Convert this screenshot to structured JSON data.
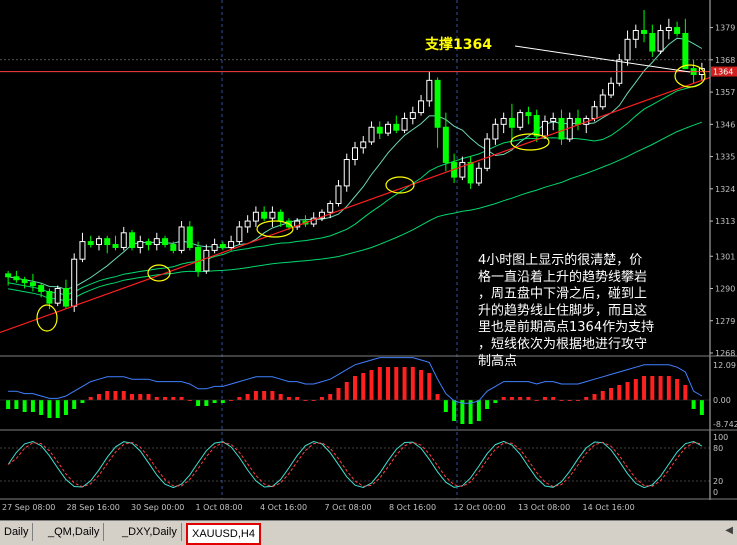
{
  "chart_data": {
    "type": "candlestick",
    "symbol": "XAUUSD",
    "timeframe": "H4",
    "colors": {
      "background": "#000000",
      "up_candle": "#ffffff",
      "down_candle": "#00ff00",
      "ma_fast": "#7fffd4",
      "ma_slow": "#00ff7f",
      "trendline": "#ff2020",
      "support_line": "#ff4040",
      "annotation": "#ffff00",
      "macd_pos": "#ff2020",
      "macd_neg": "#00ff00",
      "grid": "#3050a0"
    },
    "price_axis": {
      "ylim": [
        1268,
        1385
      ],
      "ticks": [
        "1379",
        "1368",
        "1364",
        "1357",
        "1346",
        "1335",
        "1324",
        "1313",
        "1301",
        "1290",
        "1279",
        "1268"
      ]
    },
    "time_axis": {
      "ticks": [
        "27 Sep 08:00",
        "28 Sep 16:00",
        "30 Sep 00:00",
        "1 Oct 08:00",
        "4 Oct 16:00",
        "7 Oct 08:00",
        "8 Oct 16:00",
        "12 Oct 00:00",
        "13 Oct 08:00",
        "14 Oct 16:00"
      ]
    },
    "candles": [
      [
        1295,
        1296,
        1291,
        1294
      ],
      [
        1294,
        1296,
        1292,
        1293
      ],
      [
        1293,
        1294,
        1290,
        1292
      ],
      [
        1292,
        1295,
        1289,
        1291
      ],
      [
        1291,
        1292,
        1287,
        1289
      ],
      [
        1289,
        1290,
        1283,
        1285
      ],
      [
        1285,
        1291,
        1284,
        1290
      ],
      [
        1290,
        1293,
        1283,
        1284
      ],
      [
        1284,
        1302,
        1282,
        1300
      ],
      [
        1300,
        1309,
        1299,
        1306
      ],
      [
        1306,
        1308,
        1304,
        1305
      ],
      [
        1305,
        1308,
        1303,
        1307
      ],
      [
        1307,
        1308,
        1302,
        1305
      ],
      [
        1305,
        1308,
        1303,
        1304
      ],
      [
        1304,
        1311,
        1303,
        1309
      ],
      [
        1309,
        1310,
        1303,
        1304
      ],
      [
        1304,
        1308,
        1302,
        1306
      ],
      [
        1306,
        1307,
        1303,
        1305
      ],
      [
        1305,
        1309,
        1303,
        1307
      ],
      [
        1307,
        1308,
        1304,
        1305
      ],
      [
        1305,
        1306,
        1302,
        1303
      ],
      [
        1303,
        1313,
        1302,
        1311
      ],
      [
        1311,
        1313,
        1303,
        1304
      ],
      [
        1304,
        1306,
        1294,
        1296
      ],
      [
        1296,
        1305,
        1295,
        1303
      ],
      [
        1303,
        1307,
        1302,
        1305
      ],
      [
        1305,
        1306,
        1303,
        1304
      ],
      [
        1304,
        1308,
        1303,
        1306
      ],
      [
        1306,
        1313,
        1305,
        1311
      ],
      [
        1311,
        1315,
        1309,
        1313
      ],
      [
        1313,
        1318,
        1311,
        1316
      ],
      [
        1316,
        1318,
        1313,
        1314
      ],
      [
        1314,
        1318,
        1311,
        1316
      ],
      [
        1316,
        1317,
        1311,
        1313
      ],
      [
        1313,
        1314,
        1310,
        1311
      ],
      [
        1311,
        1314,
        1310,
        1313
      ],
      [
        1313,
        1315,
        1311,
        1312
      ],
      [
        1312,
        1316,
        1311,
        1314
      ],
      [
        1314,
        1317,
        1313,
        1316
      ],
      [
        1316,
        1320,
        1314,
        1319
      ],
      [
        1319,
        1327,
        1318,
        1325
      ],
      [
        1325,
        1336,
        1323,
        1334
      ],
      [
        1334,
        1340,
        1332,
        1338
      ],
      [
        1338,
        1342,
        1336,
        1340
      ],
      [
        1340,
        1347,
        1339,
        1345
      ],
      [
        1345,
        1347,
        1341,
        1343
      ],
      [
        1343,
        1347,
        1342,
        1346
      ],
      [
        1346,
        1349,
        1343,
        1344
      ],
      [
        1344,
        1350,
        1343,
        1348
      ],
      [
        1348,
        1352,
        1346,
        1350
      ],
      [
        1350,
        1356,
        1349,
        1354
      ],
      [
        1354,
        1364,
        1352,
        1361
      ],
      [
        1361,
        1362,
        1338,
        1345
      ],
      [
        1345,
        1350,
        1330,
        1333
      ],
      [
        1333,
        1336,
        1326,
        1328
      ],
      [
        1328,
        1335,
        1327,
        1333
      ],
      [
        1333,
        1335,
        1324,
        1326
      ],
      [
        1326,
        1333,
        1325,
        1331
      ],
      [
        1331,
        1343,
        1330,
        1341
      ],
      [
        1341,
        1348,
        1339,
        1346
      ],
      [
        1346,
        1350,
        1343,
        1348
      ],
      [
        1348,
        1353,
        1340,
        1345
      ],
      [
        1345,
        1351,
        1344,
        1350
      ],
      [
        1350,
        1352,
        1346,
        1349
      ],
      [
        1349,
        1351,
        1340,
        1342
      ],
      [
        1342,
        1349,
        1341,
        1347
      ],
      [
        1347,
        1350,
        1344,
        1348
      ],
      [
        1348,
        1351,
        1339,
        1341
      ],
      [
        1341,
        1350,
        1340,
        1348
      ],
      [
        1348,
        1351,
        1344,
        1346
      ],
      [
        1346,
        1349,
        1343,
        1348
      ],
      [
        1348,
        1354,
        1347,
        1352
      ],
      [
        1352,
        1358,
        1351,
        1356
      ],
      [
        1356,
        1362,
        1355,
        1360
      ],
      [
        1360,
        1370,
        1359,
        1368
      ],
      [
        1368,
        1378,
        1366,
        1375
      ],
      [
        1375,
        1380,
        1372,
        1378
      ],
      [
        1378,
        1385,
        1374,
        1377
      ],
      [
        1377,
        1380,
        1369,
        1371
      ],
      [
        1371,
        1380,
        1370,
        1378
      ],
      [
        1378,
        1382,
        1375,
        1379
      ],
      [
        1379,
        1381,
        1376,
        1377
      ],
      [
        1377,
        1382,
        1370,
        1365
      ],
      [
        1365,
        1368,
        1360,
        1363
      ],
      [
        1363,
        1367,
        1361,
        1365
      ]
    ],
    "support_level": 1364,
    "current_price": "1364",
    "title_annotation": "支撑1364",
    "commentary": [
      "4小时图上显示的很清楚，价",
      "格一直沿着上升的趋势线攀岩",
      "，周五盘中下滑之后，碰到上",
      "升的趋势线止住脚步，而且这",
      "里也是前期高点1364作为支持",
      "，短线依次为根据地进行攻守",
      "制高点"
    ],
    "macd_panel": {
      "ticks": [
        "12.09",
        "0.00",
        "-8.742"
      ],
      "values": [
        -3,
        -3,
        -4,
        -4,
        -5,
        -6,
        -6,
        -5,
        -3,
        -1,
        1,
        2,
        3,
        3,
        3,
        2,
        2,
        2,
        1,
        1,
        1,
        1,
        0,
        -2,
        -2,
        -1,
        -1,
        0,
        1,
        2,
        3,
        3,
        3,
        2,
        1,
        1,
        0,
        0,
        1,
        2,
        4,
        6,
        8,
        9,
        10,
        11,
        11,
        11,
        11,
        11,
        10,
        9,
        2,
        -4,
        -7,
        -8,
        -8,
        -7,
        -3,
        -1,
        1,
        1,
        1,
        1,
        0,
        1,
        1,
        0,
        0,
        0,
        1,
        2,
        3,
        4,
        5,
        6,
        7,
        8,
        8,
        8,
        8,
        7,
        5,
        -3,
        -5
      ]
    },
    "stoch_panel": {
      "ticks": [
        "100",
        "80",
        "20",
        "0"
      ]
    },
    "tabs": [
      "Daily",
      "_QM,Daily",
      "_DXY,Daily",
      "XAUUSD,H4"
    ],
    "active_tab": "XAUUSD,H4"
  }
}
